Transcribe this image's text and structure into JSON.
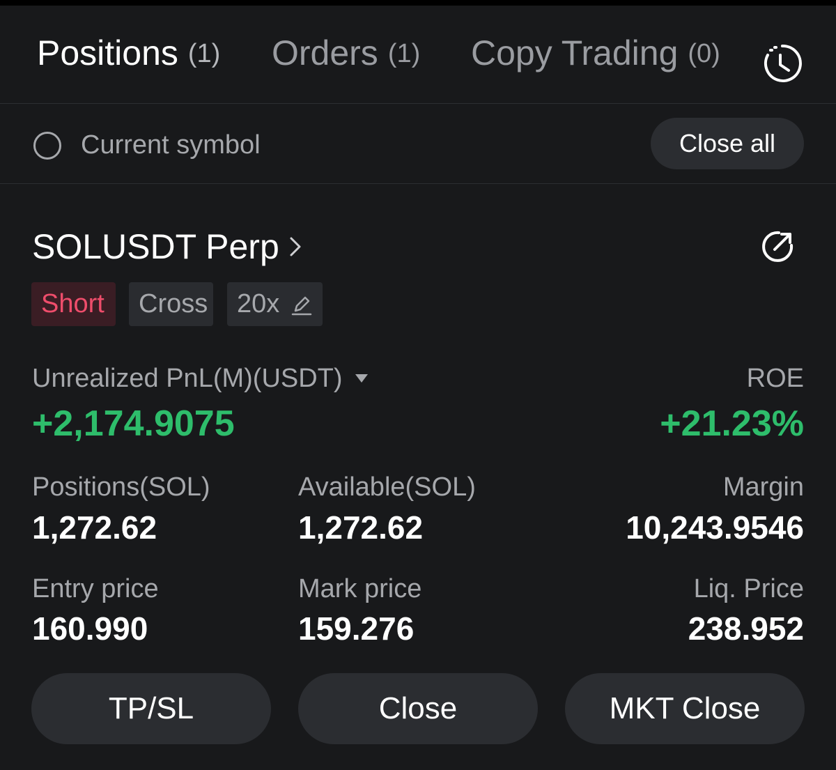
{
  "tabs": [
    {
      "label": "Positions",
      "count": "(1)"
    },
    {
      "label": "Orders",
      "count": "(1)"
    },
    {
      "label": "Copy Trading",
      "count": "(0)"
    }
  ],
  "filter": {
    "label": "Current symbol",
    "close_all_label": "Close all"
  },
  "position": {
    "symbol": "SOLUSDT Perp",
    "tags": {
      "side": "Short",
      "margin_mode": "Cross",
      "leverage": "20x"
    },
    "pnl_label": "Unrealized PnL(M)(USDT)",
    "pnl_value": "+2,174.9075",
    "roe_label": "ROE",
    "roe_value": "+21.23%",
    "positions_label": "Positions(SOL)",
    "positions_value": "1,272.62",
    "available_label": "Available(SOL)",
    "available_value": "1,272.62",
    "margin_label": "Margin",
    "margin_value": "10,243.9546",
    "entry_label": "Entry price",
    "entry_value": "160.990",
    "mark_label": "Mark price",
    "mark_value": "159.276",
    "liq_label": "Liq. Price",
    "liq_value": "238.952"
  },
  "actions": {
    "tpsl": "TP/SL",
    "close": "Close",
    "mkt_close": "MKT Close"
  },
  "colors": {
    "background": "#18191b",
    "profit": "#2ebd6b",
    "short": "#ee4d6b",
    "button": "#2b2d31"
  },
  "icons": [
    "history-icon",
    "chevron-right-icon",
    "share-icon",
    "edit-pencil-icon",
    "caret-down-icon"
  ]
}
